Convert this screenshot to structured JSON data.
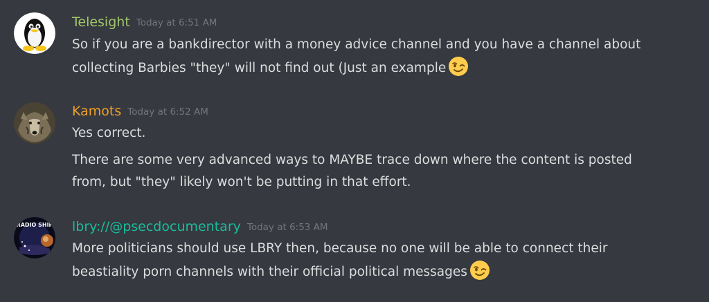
{
  "messages": [
    {
      "author": "Telesight",
      "author_color": "#a1c76c",
      "timestamp": "Today at 6:51 AM",
      "avatar": "penguin-avatar",
      "lines": [
        "So if you are a bankdirector with a money advice channel and you have a channel about",
        "collecting Barbies \"they\" will not find out (Just an example"
      ],
      "emoji": "winking-face-emoji"
    },
    {
      "author": "Kamots",
      "author_color": "#f0a02a",
      "timestamp": "Today at 6:52 AM",
      "avatar": "wolf-avatar",
      "lines": [
        "Yes correct.",
        "There are some very advanced ways to MAYBE trace down where the content is posted",
        "from, but \"they\" likely won't be putting in that effort."
      ]
    },
    {
      "author": "lbry://@psecdocumentary",
      "author_color": "#1abc9c",
      "timestamp": "Today at 6:53 AM",
      "avatar": "radio-ship-avatar",
      "avatar_text": "RADIO SHIP",
      "lines": [
        "More politicians should use LBRY then, because no one will be able to connect their",
        "beastiality porn channels with their official political messages"
      ],
      "emoji": "winking-face-emoji"
    }
  ]
}
